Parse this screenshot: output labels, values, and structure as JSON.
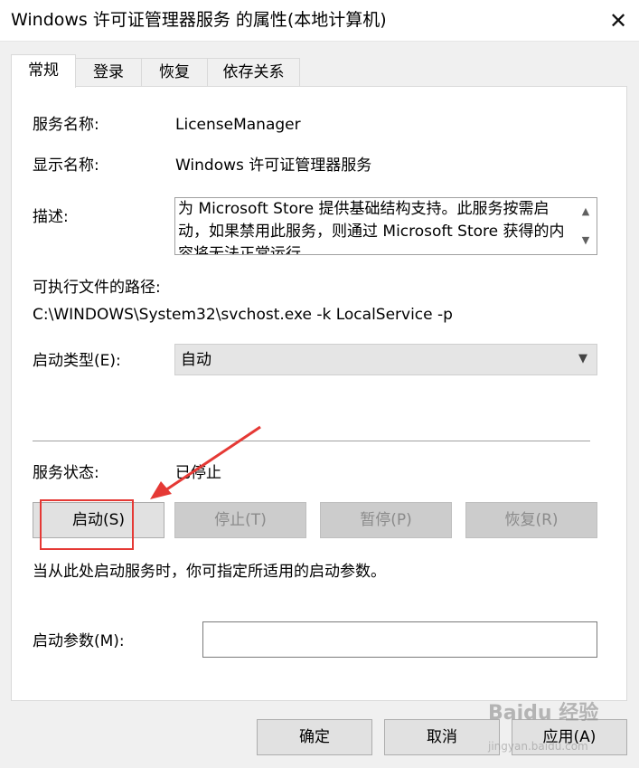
{
  "window": {
    "title": "Windows 许可证管理器服务 的属性(本地计算机)",
    "close_glyph": "✕"
  },
  "tabs": [
    {
      "label": "常规",
      "active": true
    },
    {
      "label": "登录",
      "active": false
    },
    {
      "label": "恢复",
      "active": false
    },
    {
      "label": "依存关系",
      "active": false
    }
  ],
  "general": {
    "service_name_label": "服务名称:",
    "service_name_value": "LicenseManager",
    "display_name_label": "显示名称:",
    "display_name_value": "Windows 许可证管理器服务",
    "description_label": "描述:",
    "description_value": "为 Microsoft Store 提供基础结构支持。此服务按需启动，如果禁用此服务，则通过 Microsoft Store 获得的内容将无法正常运行",
    "path_label": "可执行文件的路径:",
    "path_value": "C:\\WINDOWS\\System32\\svchost.exe -k LocalService -p",
    "startup_type_label": "启动类型(E):",
    "startup_type_value": "自动",
    "status_label": "服务状态:",
    "status_value": "已停止",
    "hint": "当从此处启动服务时，你可指定所适用的启动参数。",
    "start_params_label": "启动参数(M):",
    "start_params_value": ""
  },
  "service_buttons": {
    "start": "启动(S)",
    "stop": "停止(T)",
    "pause": "暂停(P)",
    "resume": "恢复(R)"
  },
  "footer_buttons": {
    "ok": "确定",
    "cancel": "取消",
    "apply": "应用(A)"
  },
  "watermark": {
    "brand": "Baidu 经验",
    "url": "jingyan.baidu.com"
  },
  "colors": {
    "annotation": "#e53935",
    "disabled_text": "#8b8b8b"
  }
}
